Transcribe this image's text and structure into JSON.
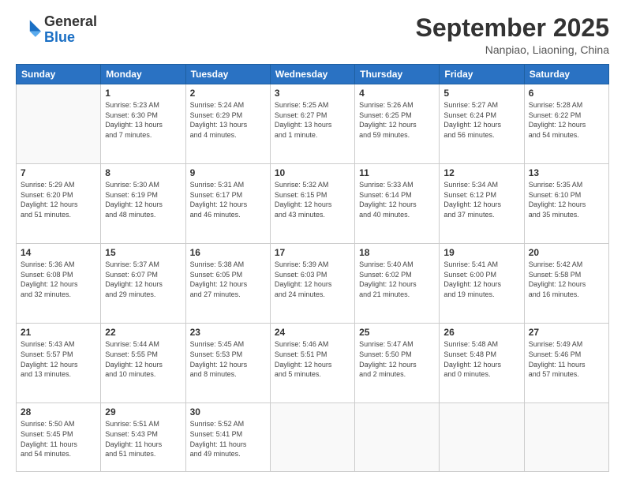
{
  "header": {
    "logo_general": "General",
    "logo_blue": "Blue",
    "month_title": "September 2025",
    "subtitle": "Nanpiao, Liaoning, China"
  },
  "days_of_week": [
    "Sunday",
    "Monday",
    "Tuesday",
    "Wednesday",
    "Thursday",
    "Friday",
    "Saturday"
  ],
  "weeks": [
    [
      {
        "day": "",
        "info": ""
      },
      {
        "day": "1",
        "info": "Sunrise: 5:23 AM\nSunset: 6:30 PM\nDaylight: 13 hours\nand 7 minutes."
      },
      {
        "day": "2",
        "info": "Sunrise: 5:24 AM\nSunset: 6:29 PM\nDaylight: 13 hours\nand 4 minutes."
      },
      {
        "day": "3",
        "info": "Sunrise: 5:25 AM\nSunset: 6:27 PM\nDaylight: 13 hours\nand 1 minute."
      },
      {
        "day": "4",
        "info": "Sunrise: 5:26 AM\nSunset: 6:25 PM\nDaylight: 12 hours\nand 59 minutes."
      },
      {
        "day": "5",
        "info": "Sunrise: 5:27 AM\nSunset: 6:24 PM\nDaylight: 12 hours\nand 56 minutes."
      },
      {
        "day": "6",
        "info": "Sunrise: 5:28 AM\nSunset: 6:22 PM\nDaylight: 12 hours\nand 54 minutes."
      }
    ],
    [
      {
        "day": "7",
        "info": "Sunrise: 5:29 AM\nSunset: 6:20 PM\nDaylight: 12 hours\nand 51 minutes."
      },
      {
        "day": "8",
        "info": "Sunrise: 5:30 AM\nSunset: 6:19 PM\nDaylight: 12 hours\nand 48 minutes."
      },
      {
        "day": "9",
        "info": "Sunrise: 5:31 AM\nSunset: 6:17 PM\nDaylight: 12 hours\nand 46 minutes."
      },
      {
        "day": "10",
        "info": "Sunrise: 5:32 AM\nSunset: 6:15 PM\nDaylight: 12 hours\nand 43 minutes."
      },
      {
        "day": "11",
        "info": "Sunrise: 5:33 AM\nSunset: 6:14 PM\nDaylight: 12 hours\nand 40 minutes."
      },
      {
        "day": "12",
        "info": "Sunrise: 5:34 AM\nSunset: 6:12 PM\nDaylight: 12 hours\nand 37 minutes."
      },
      {
        "day": "13",
        "info": "Sunrise: 5:35 AM\nSunset: 6:10 PM\nDaylight: 12 hours\nand 35 minutes."
      }
    ],
    [
      {
        "day": "14",
        "info": "Sunrise: 5:36 AM\nSunset: 6:08 PM\nDaylight: 12 hours\nand 32 minutes."
      },
      {
        "day": "15",
        "info": "Sunrise: 5:37 AM\nSunset: 6:07 PM\nDaylight: 12 hours\nand 29 minutes."
      },
      {
        "day": "16",
        "info": "Sunrise: 5:38 AM\nSunset: 6:05 PM\nDaylight: 12 hours\nand 27 minutes."
      },
      {
        "day": "17",
        "info": "Sunrise: 5:39 AM\nSunset: 6:03 PM\nDaylight: 12 hours\nand 24 minutes."
      },
      {
        "day": "18",
        "info": "Sunrise: 5:40 AM\nSunset: 6:02 PM\nDaylight: 12 hours\nand 21 minutes."
      },
      {
        "day": "19",
        "info": "Sunrise: 5:41 AM\nSunset: 6:00 PM\nDaylight: 12 hours\nand 19 minutes."
      },
      {
        "day": "20",
        "info": "Sunrise: 5:42 AM\nSunset: 5:58 PM\nDaylight: 12 hours\nand 16 minutes."
      }
    ],
    [
      {
        "day": "21",
        "info": "Sunrise: 5:43 AM\nSunset: 5:57 PM\nDaylight: 12 hours\nand 13 minutes."
      },
      {
        "day": "22",
        "info": "Sunrise: 5:44 AM\nSunset: 5:55 PM\nDaylight: 12 hours\nand 10 minutes."
      },
      {
        "day": "23",
        "info": "Sunrise: 5:45 AM\nSunset: 5:53 PM\nDaylight: 12 hours\nand 8 minutes."
      },
      {
        "day": "24",
        "info": "Sunrise: 5:46 AM\nSunset: 5:51 PM\nDaylight: 12 hours\nand 5 minutes."
      },
      {
        "day": "25",
        "info": "Sunrise: 5:47 AM\nSunset: 5:50 PM\nDaylight: 12 hours\nand 2 minutes."
      },
      {
        "day": "26",
        "info": "Sunrise: 5:48 AM\nSunset: 5:48 PM\nDaylight: 12 hours\nand 0 minutes."
      },
      {
        "day": "27",
        "info": "Sunrise: 5:49 AM\nSunset: 5:46 PM\nDaylight: 11 hours\nand 57 minutes."
      }
    ],
    [
      {
        "day": "28",
        "info": "Sunrise: 5:50 AM\nSunset: 5:45 PM\nDaylight: 11 hours\nand 54 minutes."
      },
      {
        "day": "29",
        "info": "Sunrise: 5:51 AM\nSunset: 5:43 PM\nDaylight: 11 hours\nand 51 minutes."
      },
      {
        "day": "30",
        "info": "Sunrise: 5:52 AM\nSunset: 5:41 PM\nDaylight: 11 hours\nand 49 minutes."
      },
      {
        "day": "",
        "info": ""
      },
      {
        "day": "",
        "info": ""
      },
      {
        "day": "",
        "info": ""
      },
      {
        "day": "",
        "info": ""
      }
    ]
  ]
}
